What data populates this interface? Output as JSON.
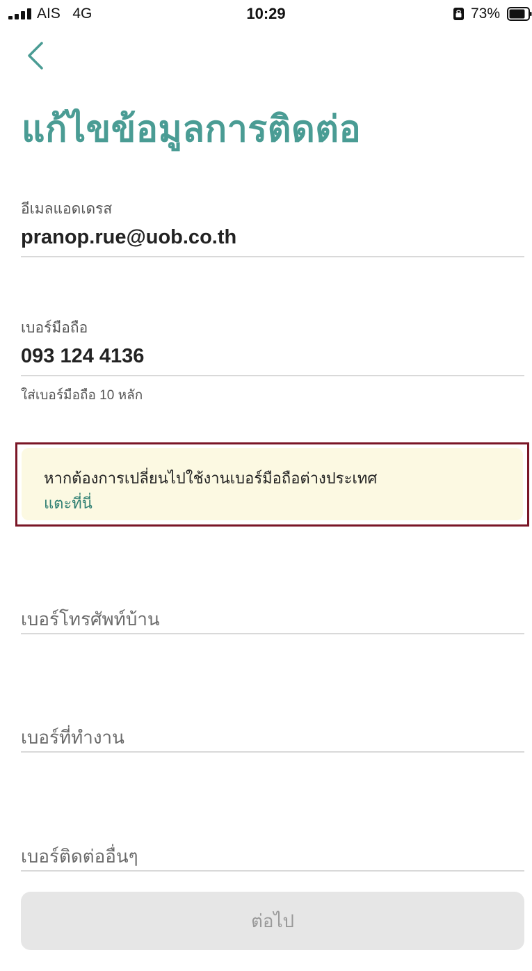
{
  "status_bar": {
    "carrier": "AIS   4G",
    "time": "10:29",
    "battery": "73%"
  },
  "icons": {
    "back": "chevron-left-icon",
    "signal": "signal-bars-icon",
    "lock": "orientation-lock-icon",
    "battery": "battery-icon"
  },
  "colors": {
    "accent": "#4a9c94",
    "link": "#2f7f72",
    "notice_bg": "#fcf9e2",
    "highlight_border": "#7a1626"
  },
  "title": "แก้ไขข้อมูลการติดต่อ",
  "email": {
    "label": "อีเมลแอดเดรส",
    "value": "pranop.rue@uob.co.th"
  },
  "mobile": {
    "label": "เบอร์มือถือ",
    "value": "093 124 4136",
    "helper": "ใส่เบอร์มือถือ 10 หลัก"
  },
  "notice": {
    "text": "หากต้องการเปลี่ยนไปใช้งานเบอร์มือถือต่างประเทศ",
    "link": "แตะที่นี่"
  },
  "home_phone": {
    "placeholder": "เบอร์โทรศัพท์บ้าน"
  },
  "work_phone": {
    "placeholder": "เบอร์ที่ทำงาน"
  },
  "other_phone": {
    "placeholder": "เบอร์ติดต่ออื่นๆ"
  },
  "next_button": {
    "label": "ต่อไป"
  }
}
